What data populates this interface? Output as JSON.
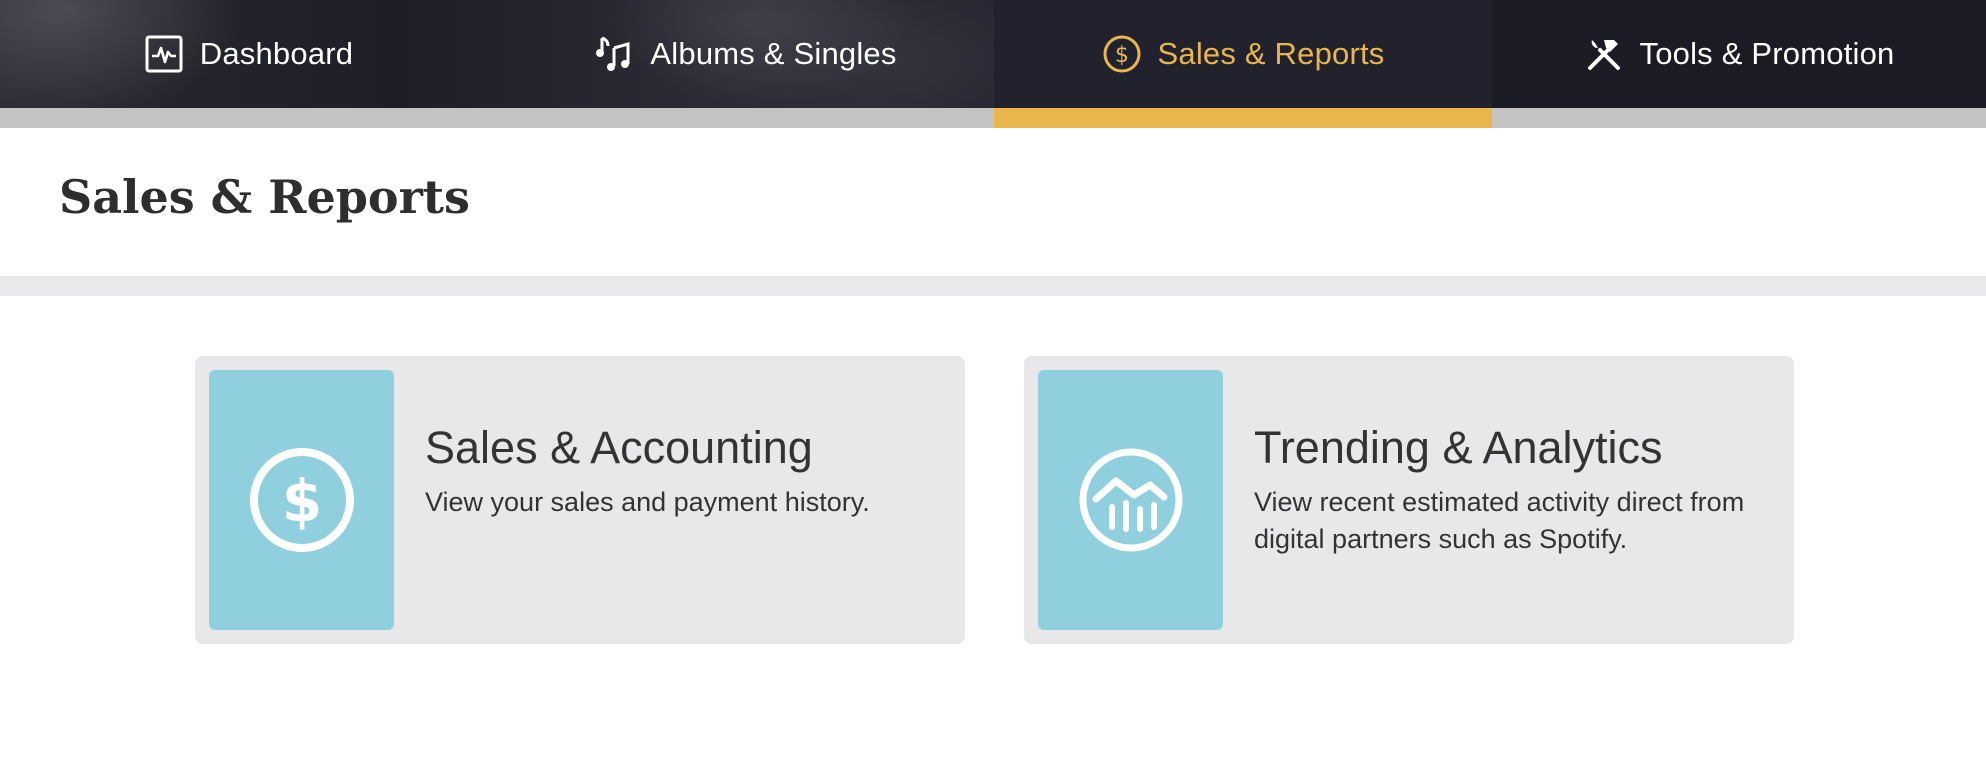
{
  "nav": {
    "tabs": [
      {
        "label": "Dashboard",
        "icon": "dashboard-icon",
        "active": false
      },
      {
        "label": "Albums & Singles",
        "icon": "music-notes-icon",
        "active": false
      },
      {
        "label": "Sales & Reports",
        "icon": "dollar-circle-icon",
        "active": true
      },
      {
        "label": "Tools & Promotion",
        "icon": "tools-icon",
        "active": false
      }
    ],
    "active_color": "#e8b64b"
  },
  "page": {
    "title": "Sales & Reports"
  },
  "cards": [
    {
      "title": "Sales & Accounting",
      "description": "View your sales and payment history.",
      "icon": "dollar-circle-icon"
    },
    {
      "title": "Trending & Analytics",
      "description": "View recent estimated activity direct from digital partners such as Spotify.",
      "icon": "trending-chart-icon"
    }
  ],
  "colors": {
    "tile": "#90cfdd",
    "card_bg": "#e8e8ea",
    "nav_bg": "#1b1b26"
  }
}
